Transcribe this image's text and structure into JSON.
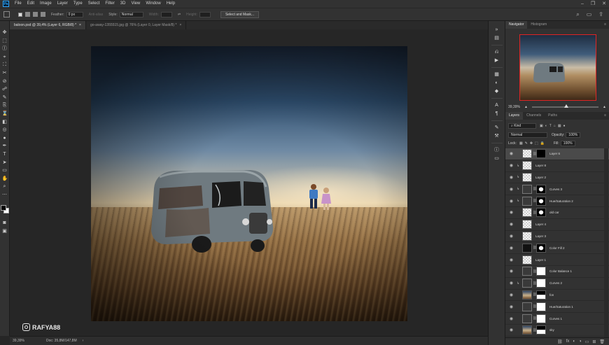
{
  "menubar": {
    "logo": "Ps",
    "items": [
      "File",
      "Edit",
      "Image",
      "Layer",
      "Type",
      "Select",
      "Filter",
      "3D",
      "View",
      "Window",
      "Help"
    ],
    "window_controls": [
      "–",
      "❐",
      "✕"
    ]
  },
  "options": {
    "feather_label": "Feather:",
    "feather_value": "0 px",
    "antialias_label": "Anti-alias",
    "style_label": "Style:",
    "style_value": "Normal",
    "width_label": "Width:",
    "height_label": "Height:",
    "select_mask_button": "Select and Mask..."
  },
  "document_tabs": [
    {
      "label": "baloon.psd @ 39,4% (Layer 6, RGB/8) *",
      "active": true
    },
    {
      "label": "go-away-1355515.jpg @ 76% (Layer 0, Layer Mask/8) *",
      "active": false
    }
  ],
  "tools": [
    "✥",
    "⬚",
    "ⓛ",
    "⌖",
    "⛶",
    "✂",
    "⊘",
    "☍",
    "✎",
    "⎘",
    "⌛",
    "◧",
    "◎",
    "●",
    "✒",
    "T",
    "➤",
    "▭",
    "✋",
    "⌕",
    "⋯"
  ],
  "watermark": "RAFYA88",
  "status": {
    "zoom": "39,39%",
    "doc": "Doc: 35,8M/147,8M",
    "arrow": "›"
  },
  "navigator": {
    "tabs": [
      "Navigator",
      "Histogram"
    ],
    "zoom_value": "39,39%"
  },
  "layers_panel": {
    "tabs": [
      "Layers",
      "Channels",
      "Paths"
    ],
    "kind_label": "⌕ Kind",
    "blend_mode": "Normal",
    "opacity_label": "Opacity:",
    "opacity_value": "100%",
    "lock_label": "Lock:",
    "fill_label": "Fill:",
    "fill_value": "100%",
    "layers": [
      {
        "name": "Layer 6",
        "thumb": "trans",
        "mask": "black",
        "selected": true,
        "clip": false
      },
      {
        "name": "Layer 8",
        "thumb": "trans",
        "mask": "",
        "selected": false,
        "clip": true
      },
      {
        "name": "Layer 2",
        "thumb": "trans",
        "mask": "",
        "selected": false,
        "clip": true
      },
      {
        "name": "Curves 3",
        "thumb": "adj",
        "mask": "blob",
        "selected": false,
        "clip": true
      },
      {
        "name": "Hue/Saturation 2",
        "thumb": "adj",
        "mask": "blob",
        "selected": false,
        "clip": true
      },
      {
        "name": "old car",
        "thumb": "trans",
        "mask": "blob",
        "selected": false,
        "clip": false
      },
      {
        "name": "Layer 4",
        "thumb": "trans",
        "mask": "",
        "selected": false,
        "clip": false
      },
      {
        "name": "Layer 3",
        "thumb": "trans",
        "mask": "",
        "selected": false,
        "clip": false
      },
      {
        "name": "Color Fill 2",
        "thumb": "dark",
        "mask": "blob",
        "selected": false,
        "clip": false
      },
      {
        "name": "Layer 1",
        "thumb": "trans",
        "mask": "",
        "selected": false,
        "clip": false
      },
      {
        "name": "Color Balance 1",
        "thumb": "adj",
        "mask": "white",
        "selected": false,
        "clip": false
      },
      {
        "name": "Curves 2",
        "thumb": "adj",
        "mask": "white",
        "selected": false,
        "clip": true
      },
      {
        "name": "fon",
        "thumb": "photo",
        "mask": "blob2",
        "selected": false,
        "clip": false
      },
      {
        "name": "Hue/Saturation 1",
        "thumb": "adj",
        "mask": "white",
        "selected": false,
        "clip": false
      },
      {
        "name": "Curves 1",
        "thumb": "adj",
        "mask": "white",
        "selected": false,
        "clip": false
      },
      {
        "name": "sky",
        "thumb": "photo",
        "mask": "blob2",
        "selected": false,
        "clip": false
      }
    ],
    "footer_icons": [
      "⛓",
      "fx",
      "◐",
      "◑",
      "▭",
      "⊞",
      "🗑"
    ]
  }
}
